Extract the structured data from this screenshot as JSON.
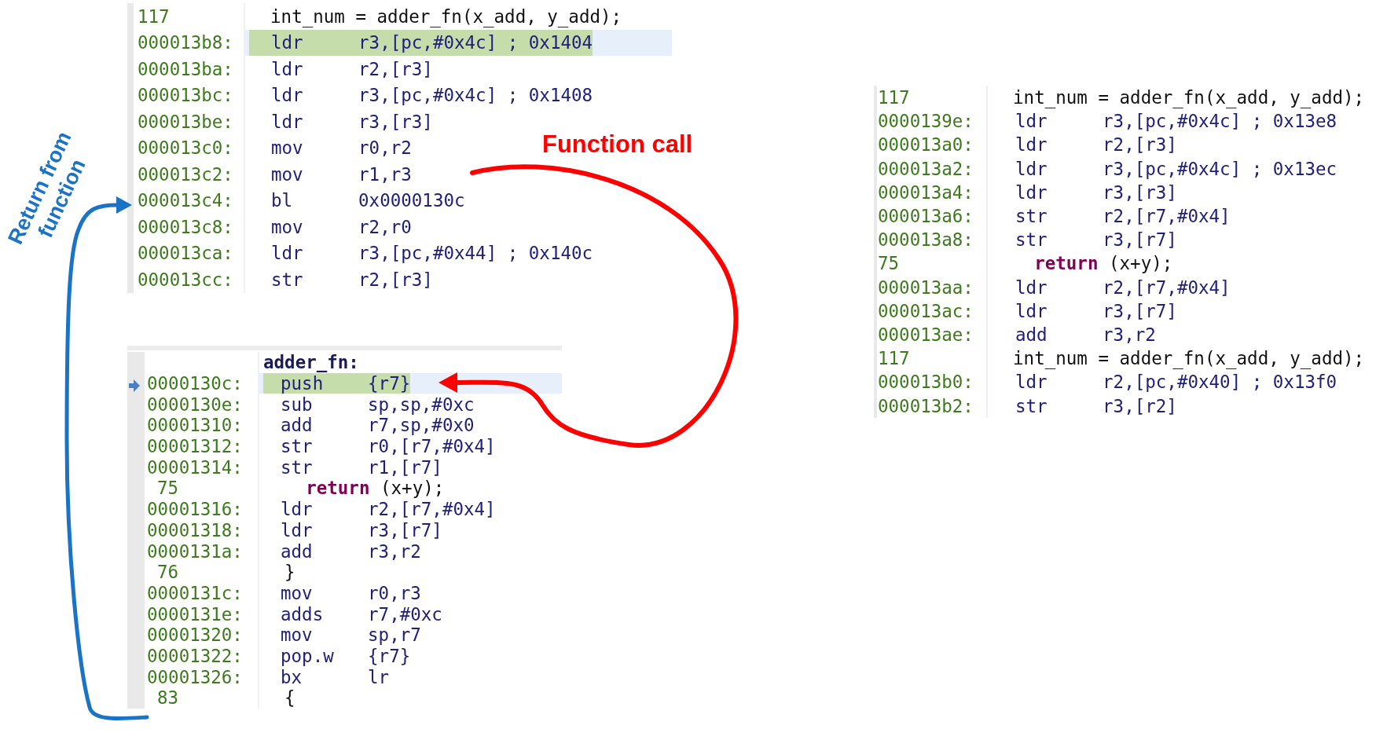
{
  "panels": [
    {
      "pc_arrow": false,
      "rows": [
        {
          "kind": "source",
          "line": "117",
          "text": "int_num = adder_fn(x_add, y_add);"
        },
        {
          "kind": "asm",
          "address": "000013b8:",
          "mnemonic": "ldr",
          "operands": "r3,[pc,#0x4c] ; 0x1404",
          "current": true
        },
        {
          "kind": "asm",
          "address": "000013ba:",
          "mnemonic": "ldr",
          "operands": "r2,[r3]",
          "current": false
        },
        {
          "kind": "asm",
          "address": "000013bc:",
          "mnemonic": "ldr",
          "operands": "r3,[pc,#0x4c] ; 0x1408",
          "current": false
        },
        {
          "kind": "asm",
          "address": "000013be:",
          "mnemonic": "ldr",
          "operands": "r3,[r3]",
          "current": false
        },
        {
          "kind": "asm",
          "address": "000013c0:",
          "mnemonic": "mov",
          "operands": "r0,r2",
          "current": false
        },
        {
          "kind": "asm",
          "address": "000013c2:",
          "mnemonic": "mov",
          "operands": "r1,r3",
          "current": false
        },
        {
          "kind": "asm",
          "address": "000013c4:",
          "mnemonic": "bl",
          "operands": "0x0000130c",
          "current": false
        },
        {
          "kind": "asm",
          "address": "000013c8:",
          "mnemonic": "mov",
          "operands": "r2,r0",
          "current": false
        },
        {
          "kind": "asm",
          "address": "000013ca:",
          "mnemonic": "ldr",
          "operands": "r3,[pc,#0x44] ; 0x140c",
          "current": false
        },
        {
          "kind": "asm",
          "address": "000013cc:",
          "mnemonic": "str",
          "operands": "r2,[r3]",
          "current": false
        }
      ]
    },
    {
      "pc_arrow": true,
      "rows": [
        {
          "kind": "label",
          "text": "adder_fn:"
        },
        {
          "kind": "asm",
          "address": "0000130c:",
          "mnemonic": "push",
          "operands": "{r7}",
          "current": true
        },
        {
          "kind": "asm",
          "address": "0000130e:",
          "mnemonic": "sub",
          "operands": "sp,sp,#0xc",
          "current": false
        },
        {
          "kind": "asm",
          "address": "00001310:",
          "mnemonic": "add",
          "operands": "r7,sp,#0x0",
          "current": false
        },
        {
          "kind": "asm",
          "address": "00001312:",
          "mnemonic": "str",
          "operands": "r0,[r7,#0x4]",
          "current": false
        },
        {
          "kind": "asm",
          "address": "00001314:",
          "mnemonic": "str",
          "operands": "r1,[r7]",
          "current": false
        },
        {
          "kind": "source",
          "line": "75",
          "keyword": "return",
          "text": "(x+y);"
        },
        {
          "kind": "asm",
          "address": "00001316:",
          "mnemonic": "ldr",
          "operands": "r2,[r7,#0x4]",
          "current": false
        },
        {
          "kind": "asm",
          "address": "00001318:",
          "mnemonic": "ldr",
          "operands": "r3,[r7]",
          "current": false
        },
        {
          "kind": "asm",
          "address": "0000131a:",
          "mnemonic": "add",
          "operands": "r3,r2",
          "current": false
        },
        {
          "kind": "source",
          "line": "76",
          "text": "}"
        },
        {
          "kind": "asm",
          "address": "0000131c:",
          "mnemonic": "mov",
          "operands": "r0,r3",
          "current": false
        },
        {
          "kind": "asm",
          "address": "0000131e:",
          "mnemonic": "adds",
          "operands": "r7,#0xc",
          "current": false
        },
        {
          "kind": "asm",
          "address": "00001320:",
          "mnemonic": "mov",
          "operands": "sp,r7",
          "current": false
        },
        {
          "kind": "asm",
          "address": "00001322:",
          "mnemonic": "pop.w",
          "operands": "{r7}",
          "current": false
        },
        {
          "kind": "asm",
          "address": "00001326:",
          "mnemonic": "bx",
          "operands": "lr",
          "current": false
        },
        {
          "kind": "source",
          "line": "83",
          "text": "{"
        }
      ]
    },
    {
      "pc_arrow": false,
      "rows": [
        {
          "kind": "source",
          "line": "117",
          "text": "int_num = adder_fn(x_add, y_add);"
        },
        {
          "kind": "asm",
          "address": "0000139e:",
          "mnemonic": "ldr",
          "operands": "r3,[pc,#0x4c] ; 0x13e8",
          "current": false
        },
        {
          "kind": "asm",
          "address": "000013a0:",
          "mnemonic": "ldr",
          "operands": "r2,[r3]",
          "current": false
        },
        {
          "kind": "asm",
          "address": "000013a2:",
          "mnemonic": "ldr",
          "operands": "r3,[pc,#0x4c] ; 0x13ec",
          "current": false
        },
        {
          "kind": "asm",
          "address": "000013a4:",
          "mnemonic": "ldr",
          "operands": "r3,[r3]",
          "current": false
        },
        {
          "kind": "asm",
          "address": "000013a6:",
          "mnemonic": "str",
          "operands": "r2,[r7,#0x4]",
          "current": false
        },
        {
          "kind": "asm",
          "address": "000013a8:",
          "mnemonic": "str",
          "operands": "r3,[r7]",
          "current": false
        },
        {
          "kind": "source",
          "line": "75",
          "keyword": "return",
          "text": "(x+y);"
        },
        {
          "kind": "asm",
          "address": "000013aa:",
          "mnemonic": "ldr",
          "operands": "r2,[r7,#0x4]",
          "current": false
        },
        {
          "kind": "asm",
          "address": "000013ac:",
          "mnemonic": "ldr",
          "operands": "r3,[r7]",
          "current": false
        },
        {
          "kind": "asm",
          "address": "000013ae:",
          "mnemonic": "add",
          "operands": "r3,r2",
          "current": false
        },
        {
          "kind": "source",
          "line": "117",
          "text": "int_num = adder_fn(x_add, y_add);"
        },
        {
          "kind": "asm",
          "address": "000013b0:",
          "mnemonic": "ldr",
          "operands": "r2,[pc,#0x40] ; 0x13f0",
          "current": false
        },
        {
          "kind": "asm",
          "address": "000013b2:",
          "mnemonic": "str",
          "operands": "r3,[r2]",
          "current": false
        }
      ]
    }
  ],
  "annotations": [
    {
      "kind": "call",
      "text": "Function call"
    },
    {
      "kind": "return",
      "text": "Return from function"
    }
  ]
}
